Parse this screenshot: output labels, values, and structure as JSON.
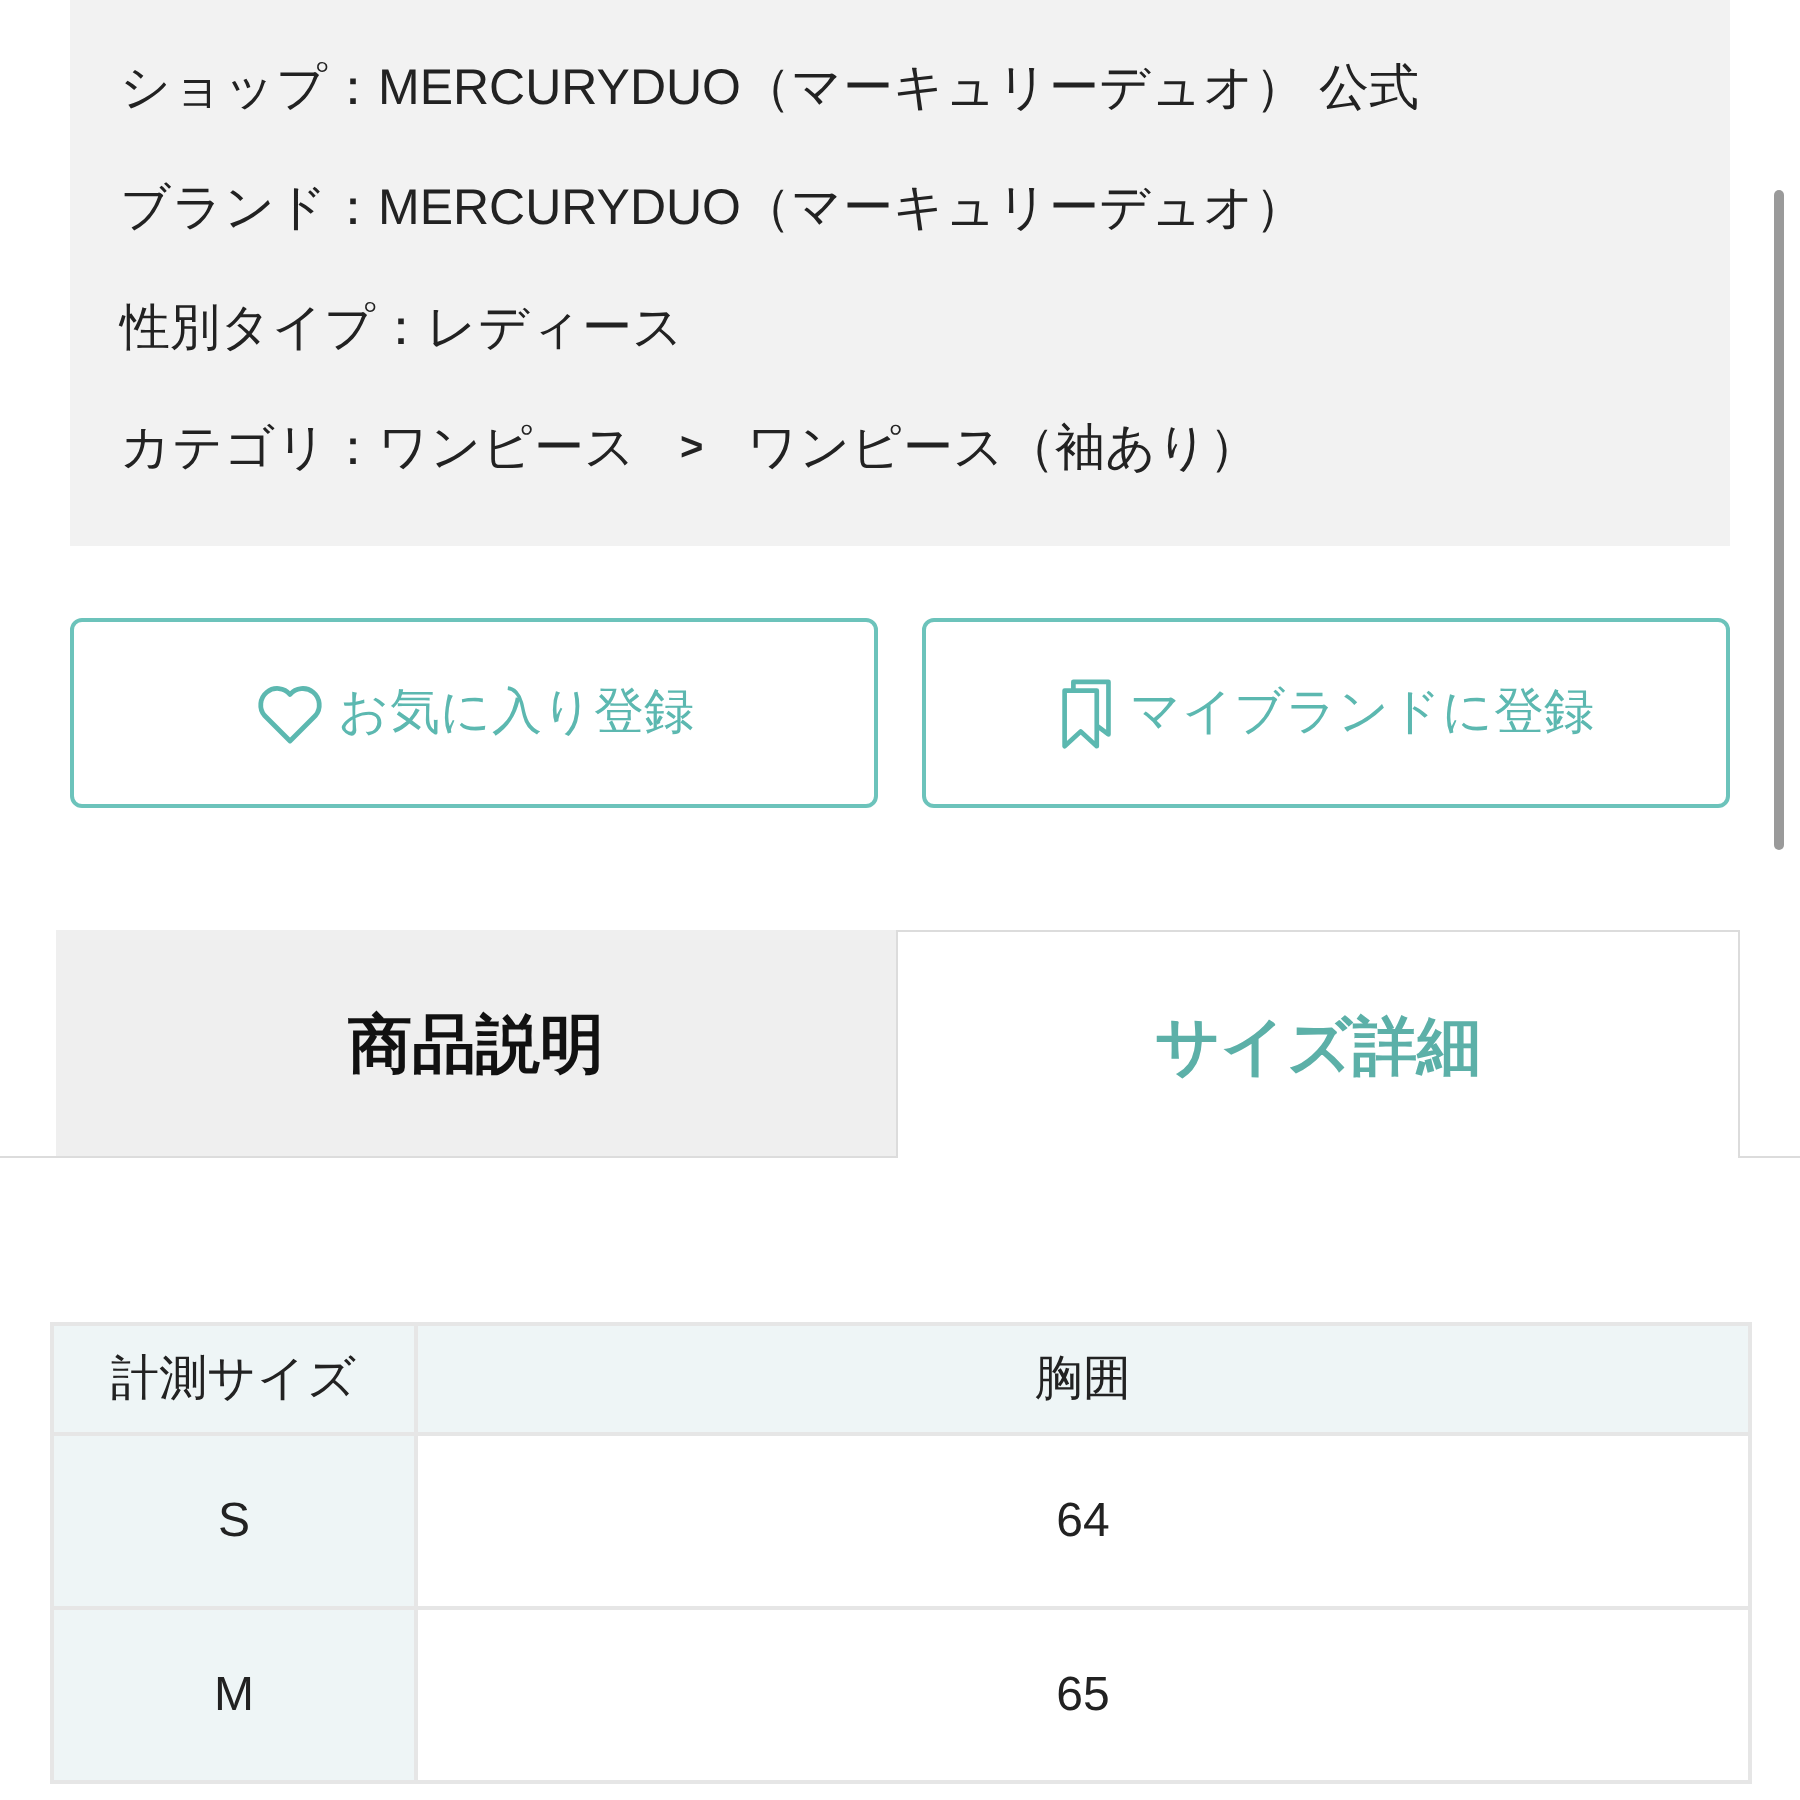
{
  "info_rows": [
    {
      "kind": "text",
      "text": "ショップ：MERCURYDUO（マーキュリーデュオ） 公式"
    },
    {
      "kind": "text",
      "text": "ブランド：MERCURYDUO（マーキュリーデュオ）"
    },
    {
      "kind": "text",
      "text": "性別タイプ：レディース"
    },
    {
      "kind": "breadcrumb",
      "items": [
        "カテゴリ：ワンピース",
        "ワンピース（袖あり）"
      ],
      "separator": ">"
    }
  ],
  "buttons": [
    {
      "kind": "favorite",
      "label": "お気に入り登録"
    },
    {
      "kind": "brand",
      "label": "マイブランドに登録"
    }
  ],
  "tabs": [
    {
      "label": "商品説明",
      "selected": false
    },
    {
      "label": "サイズ詳細",
      "selected": true
    }
  ],
  "table": {
    "columns": [
      "計測サイズ",
      "胸囲"
    ],
    "rows": [
      [
        "S",
        "64"
      ],
      [
        "M",
        "65"
      ]
    ]
  }
}
